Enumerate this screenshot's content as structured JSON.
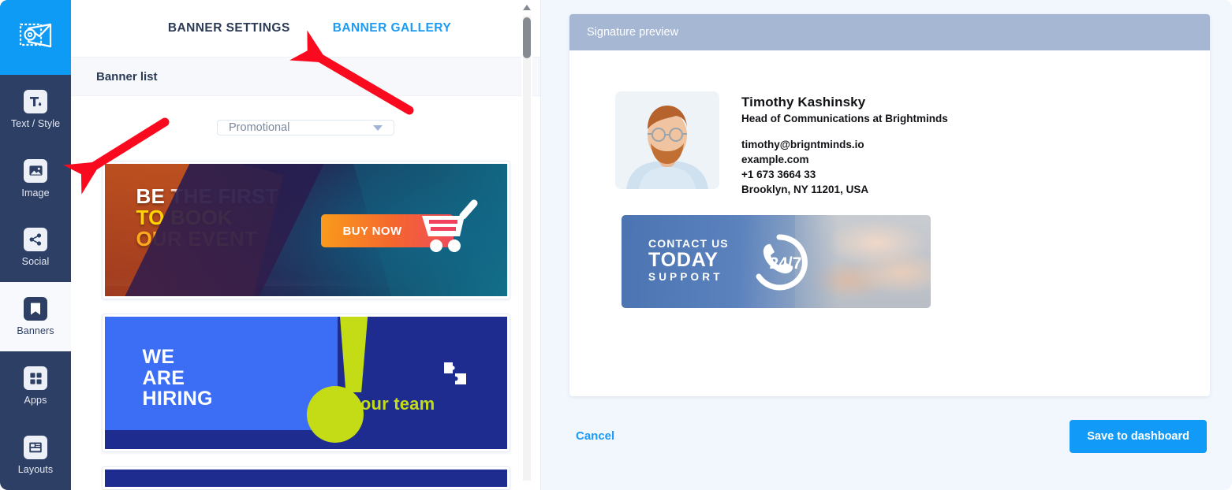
{
  "sidebar": {
    "logo_icon": "email-stamp-icon",
    "items": [
      {
        "label": "Text / Style",
        "icon": "text-style-icon",
        "active": false
      },
      {
        "label": "Image",
        "icon": "image-icon",
        "active": false
      },
      {
        "label": "Social",
        "icon": "share-icon",
        "active": false
      },
      {
        "label": "Banners",
        "icon": "bookmark-icon",
        "active": true
      },
      {
        "label": "Apps",
        "icon": "grid-apps-icon",
        "active": false
      },
      {
        "label": "Layouts",
        "icon": "layouts-icon",
        "active": false
      }
    ]
  },
  "tabs": [
    {
      "label": "BANNER SETTINGS",
      "active": false
    },
    {
      "label": "BANNER GALLERY",
      "active": true
    }
  ],
  "banner_list": {
    "header": "Banner list",
    "category_select": {
      "value": "Promotional",
      "placeholder": "Promotional",
      "caret_icon": "chevron-down-icon"
    },
    "items": [
      {
        "id": "be-the-first",
        "line1_a": "BE ",
        "line1_b": "THE FIRST",
        "line2": "TO BOOK",
        "line3": "OUR EVENT",
        "cta": "BUY NOW",
        "cta_icon": "shopping-cart-icon"
      },
      {
        "id": "we-are-hiring",
        "line1": "WE",
        "line2": "ARE",
        "line3": "HIRING",
        "cta": "Join our team",
        "cta_icon": "puzzle-icon"
      },
      {
        "id": "third-banner-partial"
      }
    ]
  },
  "scrollbar": {
    "up_arrow_icon": "scroll-up-arrow-icon"
  },
  "preview": {
    "title": "Signature preview",
    "signature": {
      "avatar_alt": "user-photo",
      "name": "Timothy Kashinsky",
      "job_title": "Head of Communications at Brightminds",
      "contacts": [
        "timothy@brigntminds.io",
        "example.com",
        "+1 673 3664 33",
        "Brooklyn, NY 11201, USA"
      ],
      "banner": {
        "line1": "CONTACT US",
        "line2": "TODAY",
        "line3": "SUPPORT",
        "badge": "24/7",
        "badge_icon": "phone-icon"
      }
    }
  },
  "footer": {
    "cancel_label": "Cancel",
    "save_label": "Save to dashboard"
  },
  "colors": {
    "accent": "#119af7",
    "sidebar": "#2e3f66",
    "preview_header": "#a6b7d4",
    "right_bg": "#f2f6fd",
    "annotation_arrow": "#fa0a1e"
  }
}
